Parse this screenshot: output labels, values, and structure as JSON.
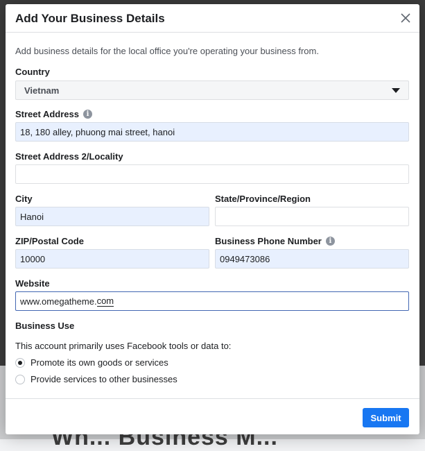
{
  "background": {
    "text": "Wh... Business M..."
  },
  "dialog": {
    "title": "Add Your Business Details",
    "close_icon": "close-icon",
    "intro": "Add business details for the local office you're operating your business from.",
    "country": {
      "label": "Country",
      "value": "Vietnam"
    },
    "street": {
      "label": "Street Address",
      "value": "18, 180 alley, phuong mai street, hanoi"
    },
    "street2": {
      "label": "Street Address 2/Locality",
      "value": ""
    },
    "city": {
      "label": "City",
      "value": "Hanoi"
    },
    "state": {
      "label": "State/Province/Region",
      "value": ""
    },
    "zip": {
      "label": "ZIP/Postal Code",
      "value": "10000"
    },
    "phone": {
      "label": "Business Phone Number",
      "value": "0949473086"
    },
    "website": {
      "label": "Website",
      "value_main": "www.omegatheme.",
      "value_tail": "com"
    },
    "business_use": {
      "label": "Business Use",
      "question": "This account primarily uses Facebook tools or data to:",
      "options": [
        {
          "label": "Promote its own goods or services",
          "checked": true
        },
        {
          "label": "Provide services to other businesses",
          "checked": false
        }
      ]
    },
    "submit": "Submit"
  }
}
